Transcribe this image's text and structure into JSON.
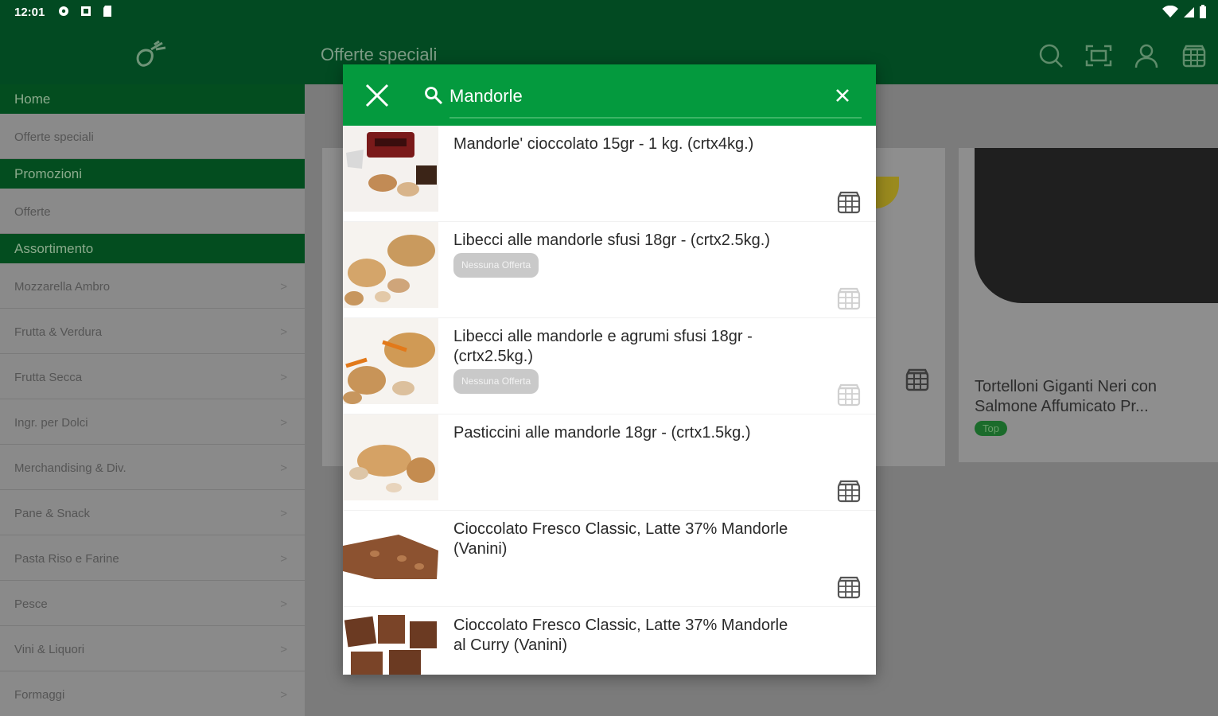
{
  "status_bar": {
    "time": "12:01"
  },
  "sidebar": {
    "items": [
      {
        "label": "Home",
        "type": "header"
      },
      {
        "label": "Offerte speciali",
        "type": "item"
      },
      {
        "label": "Promozioni",
        "type": "header"
      },
      {
        "label": "Offerte",
        "type": "item"
      },
      {
        "label": "Assortimento",
        "type": "header"
      },
      {
        "label": "Mozzarella Ambro",
        "type": "item",
        "chevron": true
      },
      {
        "label": "Frutta & Verdura",
        "type": "item",
        "chevron": true
      },
      {
        "label": "Frutta Secca",
        "type": "item",
        "chevron": true
      },
      {
        "label": "Ingr. per Dolci",
        "type": "item",
        "chevron": true
      },
      {
        "label": "Merchandising & Div.",
        "type": "item",
        "chevron": true
      },
      {
        "label": "Pane & Snack",
        "type": "item",
        "chevron": true
      },
      {
        "label": "Pasta Riso e Farine",
        "type": "item",
        "chevron": true
      },
      {
        "label": "Pesce",
        "type": "item",
        "chevron": true
      },
      {
        "label": "Vini & Liquori",
        "type": "item",
        "chevron": true
      },
      {
        "label": "Formaggi",
        "type": "item",
        "chevron": true
      }
    ],
    "chevron": ">"
  },
  "appbar": {
    "title": "Offerte speciali",
    "icons": [
      "search-icon",
      "barcode-scan-icon",
      "account-icon",
      "cart-icon"
    ]
  },
  "background_card": {
    "name": "Tortelloni Giganti Neri con Salmone Affumicato Pr...",
    "badge": "Top"
  },
  "search": {
    "query": "Mandorle",
    "results": [
      {
        "name": "Mandorle' cioccolato 15gr - 1 kg. (crtx4kg.)",
        "tag": "",
        "cart_enabled": true
      },
      {
        "name": "Libecci alle mandorle sfusi 18gr - (crtx2.5kg.)",
        "tag": "Nessuna Offerta",
        "cart_enabled": false
      },
      {
        "name": "Libecci alle mandorle e agrumi sfusi 18gr - (crtx2.5kg.)",
        "tag": "Nessuna Offerta",
        "cart_enabled": false
      },
      {
        "name": "Pasticcini alle mandorle 18gr - (crtx1.5kg.)",
        "tag": "",
        "cart_enabled": true
      },
      {
        "name": "Cioccolato Fresco Classic, Latte 37% Mandorle (Vanini)",
        "tag": "",
        "cart_enabled": true
      },
      {
        "name": "Cioccolato Fresco Classic, Latte 37% Mandorle al Curry (Vanini)",
        "tag": "",
        "cart_enabled": true
      }
    ]
  },
  "colors": {
    "dark_green": "#024a22",
    "accent_green": "#049a3e",
    "cart_enabled": "#555555",
    "cart_disabled": "#d0d0d0"
  }
}
